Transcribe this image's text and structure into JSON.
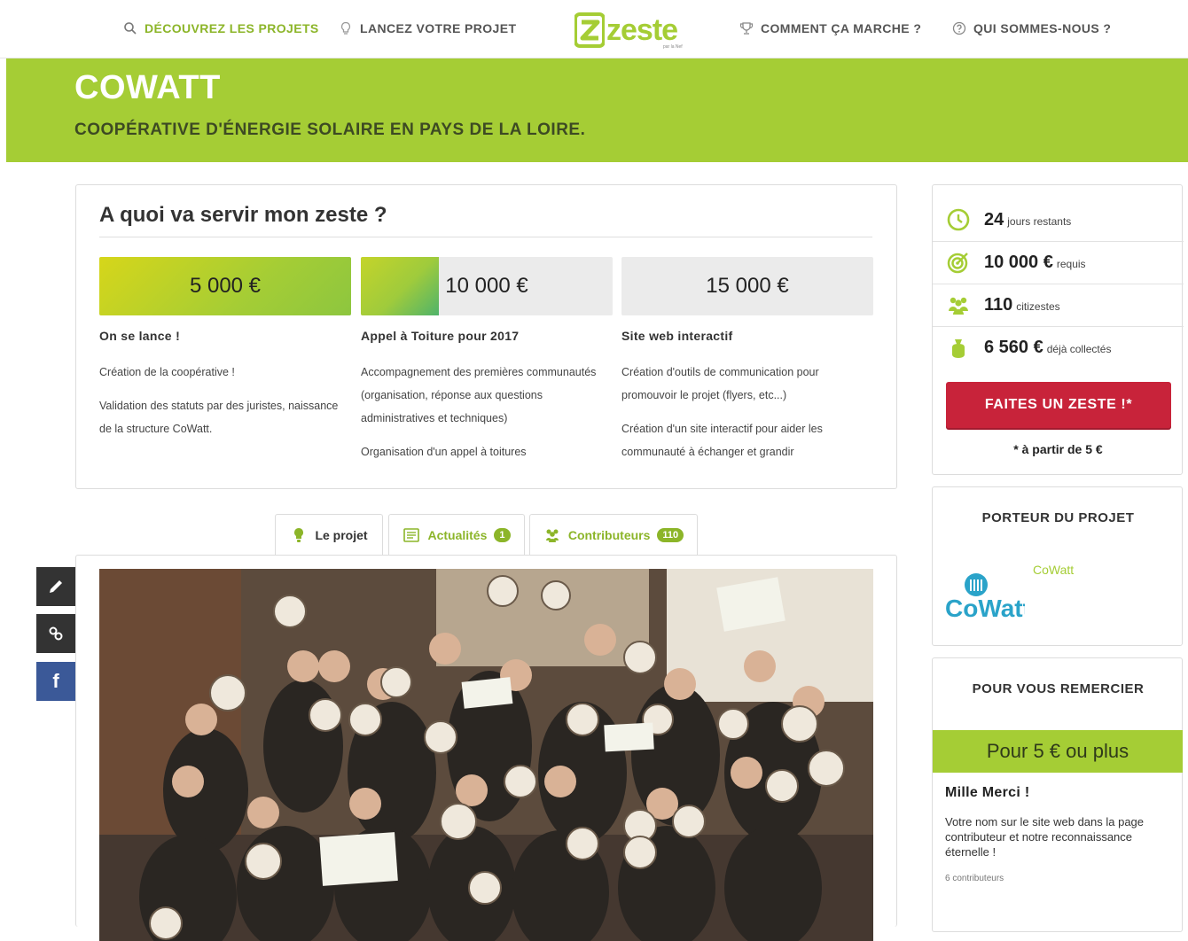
{
  "nav": {
    "items": [
      {
        "label": "Découvrez les projets"
      },
      {
        "label": "Lancez votre projet"
      },
      {
        "label": "Comment ça marche ?"
      },
      {
        "label": "Qui sommes-nous ?"
      }
    ],
    "logo_text": "zeste",
    "logo_sub": "par la Nef",
    "accent": "#a5cd35"
  },
  "project": {
    "title": "COWATT",
    "subtitle": "Coopérative d'énergie solaire en Pays de la Loire."
  },
  "goals": {
    "title": "A quoi va servir mon zeste ?",
    "tiers": [
      {
        "amount": "5 000 €",
        "fill": 1.0,
        "name": "On se lance !",
        "paragraphs": [
          "Création de la coopérative !",
          "Validation des statuts par des juristes, naissance de la structure CoWatt."
        ]
      },
      {
        "amount": "10 000 €",
        "fill": 0.31,
        "name": "Appel à Toiture pour 2017",
        "paragraphs": [
          "Accompagnement des premières communautés (organisation, réponse aux questions administratives et techniques)",
          "Organisation d'un appel à toitures"
        ]
      },
      {
        "amount": "15 000 €",
        "fill": 0.0,
        "name": "Site web interactif",
        "paragraphs": [
          "Création d'outils de communication pour promouvoir le projet (flyers, etc...)",
          "Création d'un site interactif pour aider les communauté à échanger et grandir"
        ]
      }
    ]
  },
  "tabs": {
    "project": {
      "label": "Le projet"
    },
    "news": {
      "label": "Actualités",
      "count": "1"
    },
    "contributors": {
      "label": "Contributeurs",
      "count": "110"
    }
  },
  "share": {
    "facebook": "f"
  },
  "stats": {
    "days": {
      "value": "24",
      "unit": "jours restants"
    },
    "goal": {
      "value": "10 000 €",
      "unit": "requis"
    },
    "backers": {
      "value": "110",
      "unit": "citizestes"
    },
    "collected": {
      "value": "6 560 €",
      "unit": "déjà collectés"
    },
    "cta": "FAITES UN ZESTE !*",
    "cta_note": "* à partir de 5 €",
    "cta_color": "#c8233a"
  },
  "owner": {
    "title": "Porteur du projet",
    "name": "CoWatt",
    "logo_text": "CoWatt"
  },
  "rewards": {
    "title": "Pour vous remercier",
    "first": {
      "price": "Pour 5 € ou plus",
      "name": "Mille Merci !",
      "description": "Votre nom sur le site web dans la page contributeur et notre reconnaissance éternelle !",
      "count": "6 contributeurs"
    }
  }
}
